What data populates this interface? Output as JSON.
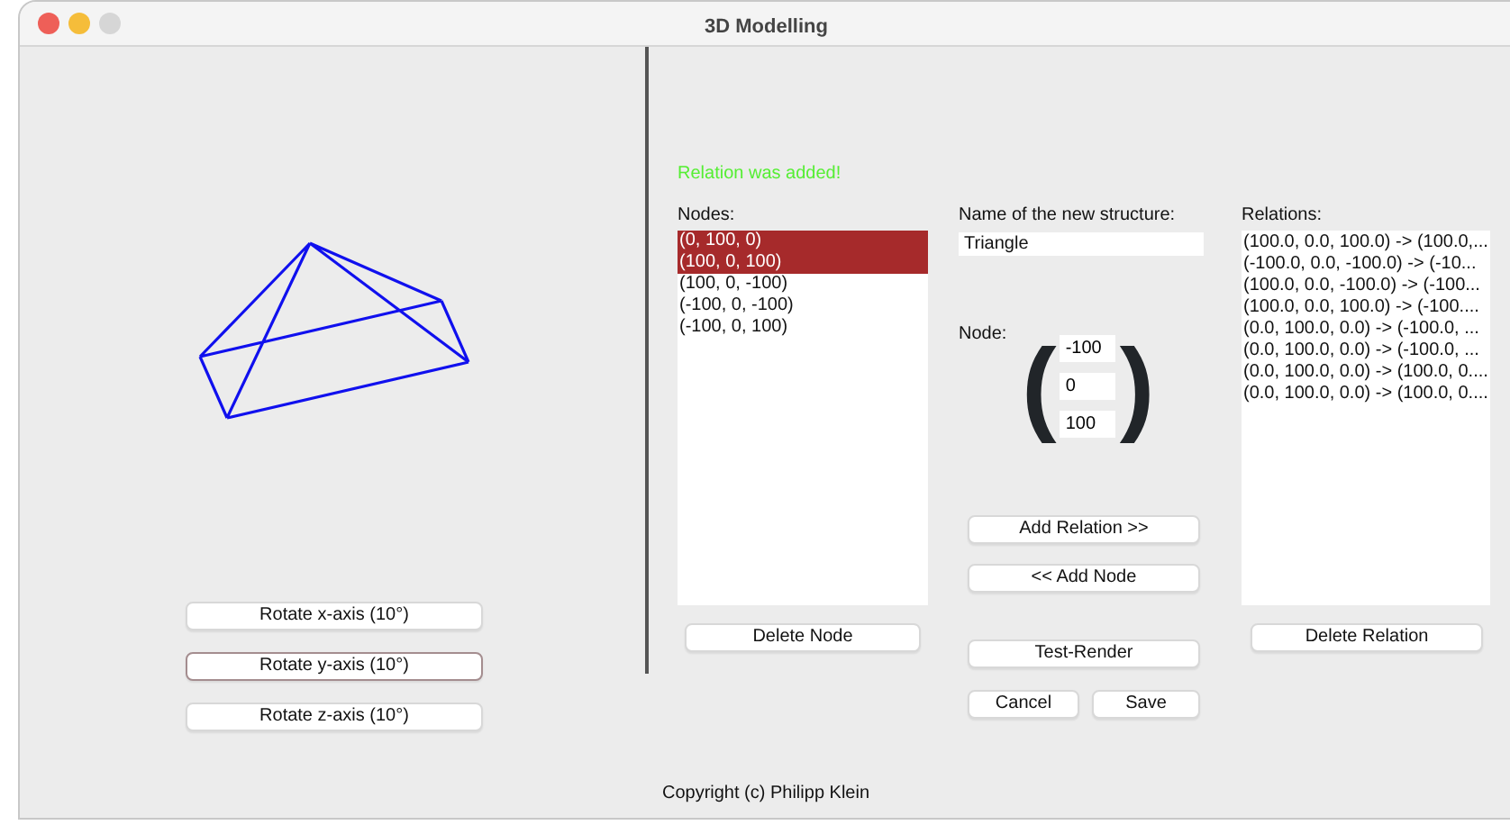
{
  "window": {
    "title": "3D Modelling"
  },
  "rotate_buttons": [
    {
      "label": "Rotate x-axis (10°)",
      "focused": false
    },
    {
      "label": "Rotate y-axis (10°)",
      "focused": true
    },
    {
      "label": "Rotate z-axis (10°)",
      "focused": false
    }
  ],
  "status_message": "Relation was added!",
  "nodes": {
    "label": "Nodes:",
    "items": [
      {
        "text": "(0, 100, 0)",
        "selected": true
      },
      {
        "text": "(100, 0, 100)",
        "selected": true
      },
      {
        "text": "(100, 0, -100)",
        "selected": false
      },
      {
        "text": "(-100, 0, -100)",
        "selected": false
      },
      {
        "text": "(-100, 0, 100)",
        "selected": false
      }
    ],
    "delete_button": "Delete Node"
  },
  "structure": {
    "label": "Name of the new structure:",
    "value": "Triangle"
  },
  "node_editor": {
    "label": "Node:",
    "bracket_open": "(",
    "bracket_close": ")",
    "values": [
      "-100",
      "0",
      "100"
    ],
    "add_relation_button": "Add Relation >>",
    "add_node_button": "<< Add Node"
  },
  "relations": {
    "label": "Relations:",
    "items": [
      "(100.0, 0.0, 100.0) -> (100.0,...",
      "(-100.0, 0.0, -100.0) -> (-10...",
      "(100.0, 0.0, -100.0) -> (-100...",
      "(100.0, 0.0, 100.0) -> (-100....",
      "(0.0, 100.0, 0.0) -> (-100.0, ...",
      "(0.0, 100.0, 0.0) -> (-100.0, ...",
      "(0.0, 100.0, 0.0) -> (100.0, 0....",
      "(0.0, 100.0, 0.0) -> (100.0, 0...."
    ],
    "delete_button": "Delete Relation"
  },
  "test_render_button": "Test-Render",
  "cancel_button": "Cancel",
  "save_button": "Save",
  "footer": "Copyright (c) Philipp Klein"
}
